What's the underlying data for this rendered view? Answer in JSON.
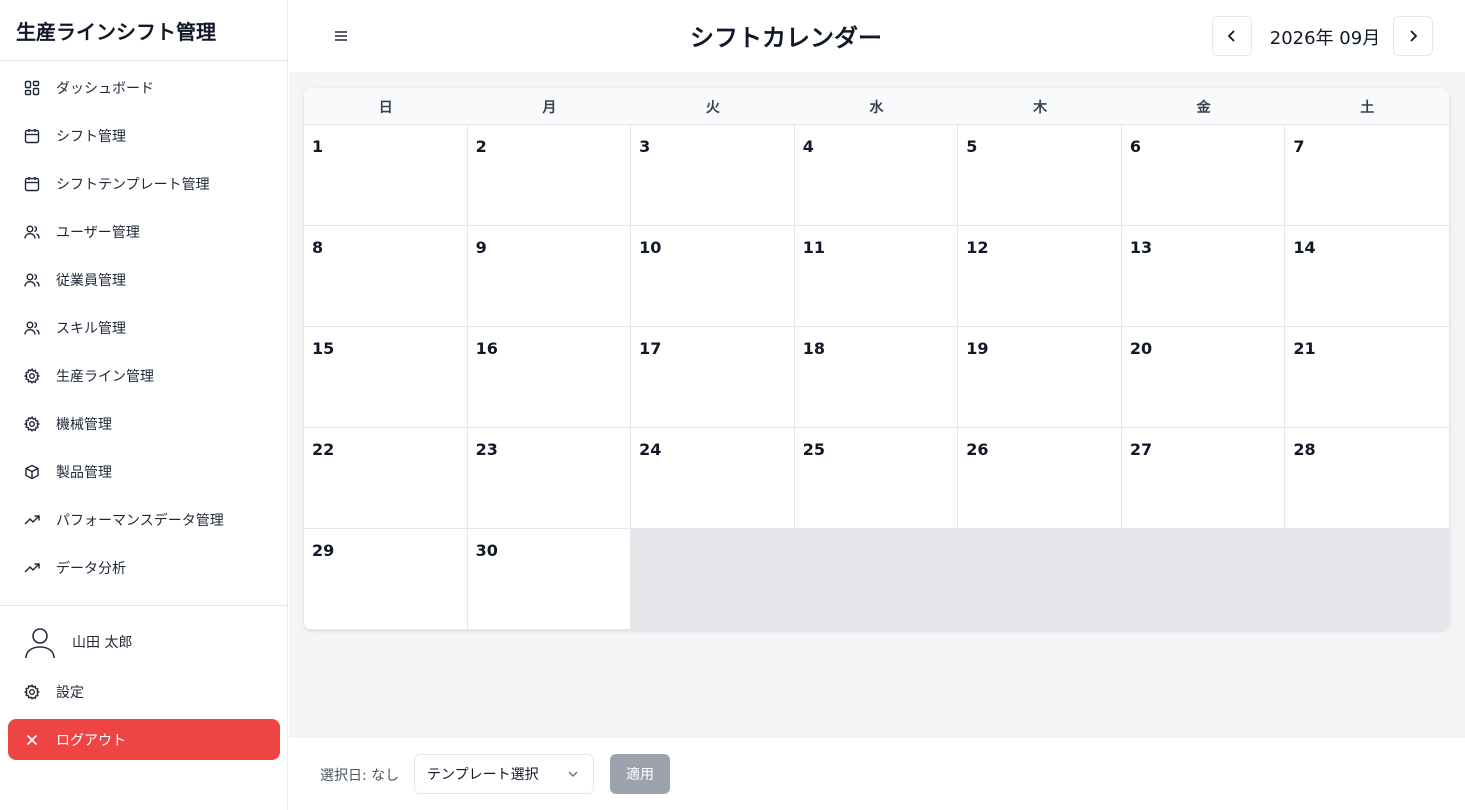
{
  "sidebar": {
    "app_title": "生産ラインシフト管理",
    "items": [
      {
        "label": "ダッシュボード",
        "icon": "dashboard-icon"
      },
      {
        "label": "シフト管理",
        "icon": "calendar-icon"
      },
      {
        "label": "シフトテンプレート管理",
        "icon": "calendar-icon"
      },
      {
        "label": "ユーザー管理",
        "icon": "users-icon"
      },
      {
        "label": "従業員管理",
        "icon": "users-icon"
      },
      {
        "label": "スキル管理",
        "icon": "users-icon"
      },
      {
        "label": "生産ライン管理",
        "icon": "gear-icon"
      },
      {
        "label": "機械管理",
        "icon": "gear-icon"
      },
      {
        "label": "製品管理",
        "icon": "box-icon"
      },
      {
        "label": "パフォーマンスデータ管理",
        "icon": "trending-up-icon"
      },
      {
        "label": "データ分析",
        "icon": "trending-up-icon"
      }
    ],
    "user_name": "山田 太郎",
    "settings_label": "設定",
    "logout_label": "ログアウト"
  },
  "header": {
    "title": "シフトカレンダー",
    "month": "2026年 09月",
    "prev_icon": "chevron-left-icon",
    "next_icon": "chevron-right-icon",
    "menu_icon": "hamburger-icon"
  },
  "calendar": {
    "weekdays": [
      "日",
      "月",
      "火",
      "水",
      "木",
      "金",
      "土"
    ],
    "weeks": [
      [
        "1",
        "2",
        "3",
        "4",
        "5",
        "6",
        "7"
      ],
      [
        "8",
        "9",
        "10",
        "11",
        "12",
        "13",
        "14"
      ],
      [
        "15",
        "16",
        "17",
        "18",
        "19",
        "20",
        "21"
      ],
      [
        "22",
        "23",
        "24",
        "25",
        "26",
        "27",
        "28"
      ],
      [
        "29",
        "30"
      ]
    ]
  },
  "footer": {
    "selected_label": "選択日: なし",
    "template_select": "テンプレート選択",
    "apply_label": "適用"
  },
  "colors": {
    "logout_bg": "#ef4444",
    "apply_bg": "#9ca3af",
    "main_bg": "#f3f4f6",
    "filler_bg": "#e5e7eb"
  }
}
